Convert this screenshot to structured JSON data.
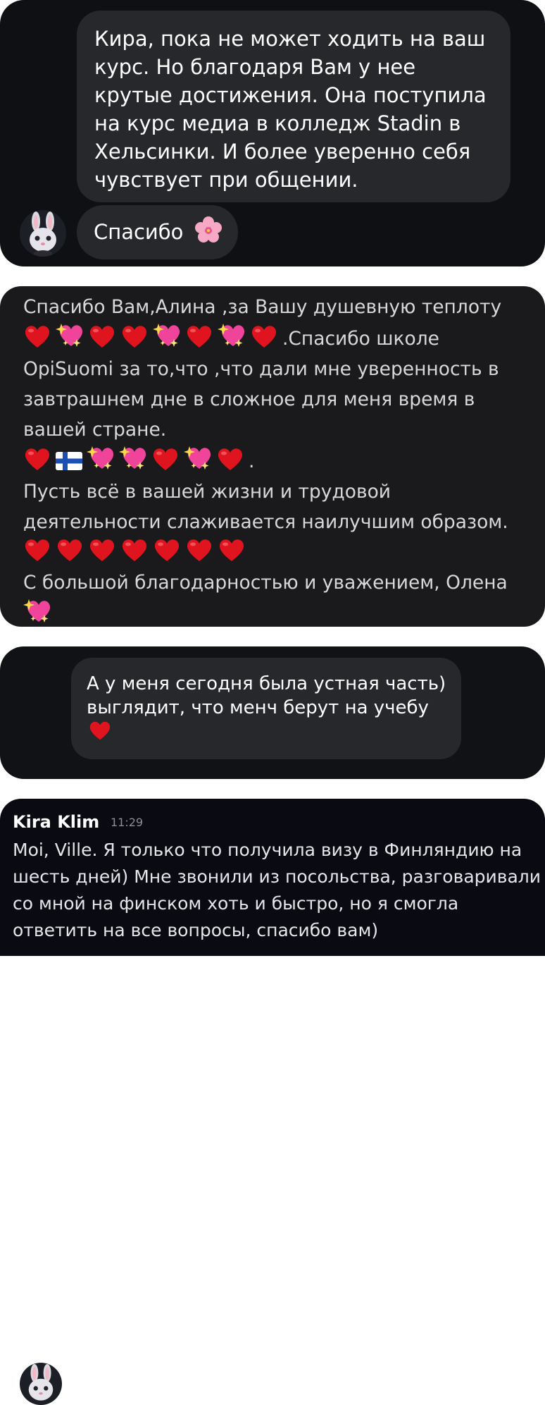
{
  "chat1": {
    "message": "Кира, пока не может ходить на ваш курс. Но благодаря Вам у нее крутые достижения. Она поступила на курс медиа в колледж Stadin в Хельсинки. И более уверенно себя чувствует при общении.",
    "reply_text": "Спасибо",
    "reply_emoji": "cherry-blossom-icon",
    "avatar": "bunny-avatar-icon"
  },
  "post": {
    "line1": "Спасибо Вам,Алина ,за Вашу душевную теплоту",
    "row1_emojis": [
      "red-heart",
      "sparkling-heart",
      "red-heart",
      "red-heart",
      "sparkling-heart",
      "red-heart",
      "sparkling-heart",
      "red-heart"
    ],
    "row1_tail": ".Спасибо школе",
    "line2": "OpiSuomi за то,что ,что дали мне уверенность в",
    "line3": "завтрашнем дне в сложное для меня время в",
    "line4": "вашей стране.",
    "row2_emojis": [
      "red-heart",
      "finland-flag",
      "sparkling-heart",
      "sparkling-heart",
      "red-heart",
      "sparkling-heart",
      "red-heart"
    ],
    "row2_tail": ".",
    "line5": "Пусть всё в вашей жизни и трудовой",
    "line6": "деятельности слаживается наилучшим образом.",
    "row3_emojis": [
      "red-heart",
      "red-heart",
      "red-heart",
      "red-heart",
      "red-heart",
      "red-heart",
      "red-heart"
    ],
    "line7": "С большой благодарностью и уважением, Олена",
    "row4_emojis": [
      "sparkling-heart"
    ]
  },
  "chat2": {
    "message": "А у меня сегодня была устная часть) выглядит, что менч берут на учебу",
    "message_emoji": "red-heart",
    "avatar": "bunny-avatar-icon"
  },
  "chat3": {
    "sender": "Kira Klim",
    "time": "11:29",
    "message": "Moi, Ville. Я только что получила визу в Финляндию на шесть дней) Мне звонили из посольства, разговаривали со мной на финском хоть и быстро, но я смогла ответить на все вопросы, спасибо вам)"
  },
  "colors": {
    "dark_card": "#0e1014",
    "bubble": "#26282c",
    "post_card": "#1a1a1c",
    "heart_red": "#e0141e",
    "sparkle_pink": "#f0449a"
  }
}
